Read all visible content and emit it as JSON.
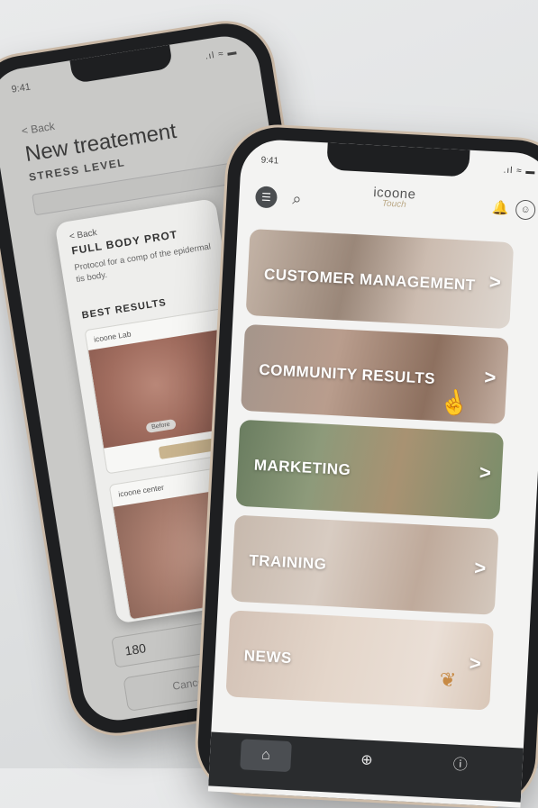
{
  "back_phone": {
    "status_time": "9:41",
    "status_icons": ".ıl ≈ ▬",
    "back_label": "< Back",
    "title": "New treatement",
    "subtitle": "STRESS LEVEL",
    "card": {
      "back_label": "< Back",
      "title": "FULL BODY PROT",
      "description": "Protocol for a comp of the epidermal tis body.",
      "best_results_label": "BEST RESULTS",
      "lab_label": "icoone Lab",
      "before_badge": "Before",
      "center_label": "icoone center"
    },
    "input_value": "180",
    "cancel_label": "Cancel"
  },
  "front_phone": {
    "status_time": "9:41",
    "status_icons": ".ıl ≈ ▬",
    "logo_text": "icoone",
    "logo_sub": "Touch",
    "menu_icon": "☰",
    "search_icon": "⌕",
    "notification_icon": "🔔",
    "profile_icon": "☺",
    "tiles": [
      {
        "label": "CUSTOMER MANAGEMENT",
        "chevron": ">"
      },
      {
        "label": "COMMUNITY RESULTS",
        "chevron": ">"
      },
      {
        "label": "MARKETING",
        "chevron": ">"
      },
      {
        "label": "TRAINING",
        "chevron": ">"
      },
      {
        "label": "NEWS",
        "chevron": ">"
      }
    ],
    "tab_icons": {
      "home": "⌂",
      "add": "⊕",
      "info": "ⓘ"
    }
  }
}
